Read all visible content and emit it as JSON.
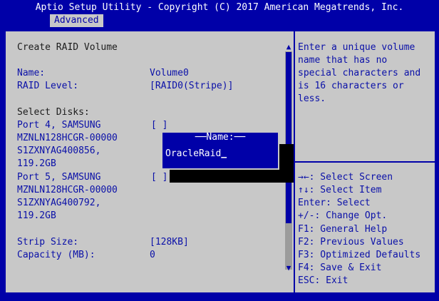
{
  "header": {
    "title": "Aptio Setup Utility - Copyright (C) 2017 American Megatrends, Inc.",
    "active_tab": "Advanced"
  },
  "left": {
    "section_title": "Create RAID Volume",
    "name_label": "Name:",
    "name_value": "Volume0",
    "raid_level_label": "RAID Level:",
    "raid_level_value": "[RAID0(Stripe)]",
    "select_disks_label": "Select Disks:",
    "disks": [
      {
        "line1": "Port 4, SAMSUNG",
        "line2": "MZNLN128HCGR-00000",
        "line3": "S1ZXNYAG400856,",
        "line4": "119.2GB",
        "checkbox": "[ ]"
      },
      {
        "line1": "Port 5, SAMSUNG",
        "line2": "MZNLN128HCGR-00000",
        "line3": "S1ZXNYAG400792,",
        "line4": "119.2GB",
        "checkbox": "[ ]"
      }
    ],
    "strip_size_label": "Strip Size:",
    "strip_size_value": "[128KB]",
    "capacity_label": "Capacity (MB):",
    "capacity_value": "0"
  },
  "popup": {
    "title": "Name:",
    "input_value": "OracleRaid",
    "cursor_char": "_"
  },
  "help": {
    "lines": [
      "Enter a unique volume",
      "name that has no",
      "special characters and",
      "is 16 characters or",
      "less."
    ]
  },
  "keys": {
    "lines": [
      "→←: Select Screen",
      "↑↓: Select Item",
      "Enter: Select",
      "+/-: Change Opt.",
      "F1: General Help",
      "F2: Previous Values",
      "F3: Optimized Defaults",
      "F4: Save & Exit",
      "ESC: Exit"
    ]
  },
  "colors": {
    "background": "#0000a8",
    "panel": "#c8c8c8",
    "text_dark": "#1c1c1c",
    "text_blue": "#0a10a8",
    "white": "#ffffff"
  }
}
